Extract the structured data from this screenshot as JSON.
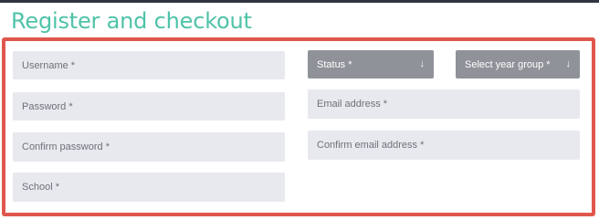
{
  "page": {
    "title": "Register and checkout"
  },
  "form": {
    "username": {
      "placeholder": "Username *"
    },
    "password": {
      "placeholder": "Password *"
    },
    "confirm_password": {
      "placeholder": "Confirm password *"
    },
    "school": {
      "placeholder": "School *"
    },
    "status": {
      "label": "Status *"
    },
    "year_group": {
      "label": "Select year group *"
    },
    "email": {
      "placeholder": "Email address *"
    },
    "confirm_email": {
      "placeholder": "Confirm email address *"
    }
  },
  "icons": {
    "select_arrow": "↓"
  },
  "colors": {
    "title": "#4fc3a8",
    "highlight_border": "#e0564c",
    "field_bg": "#e8e9ee",
    "select_bg": "#8f9298"
  }
}
